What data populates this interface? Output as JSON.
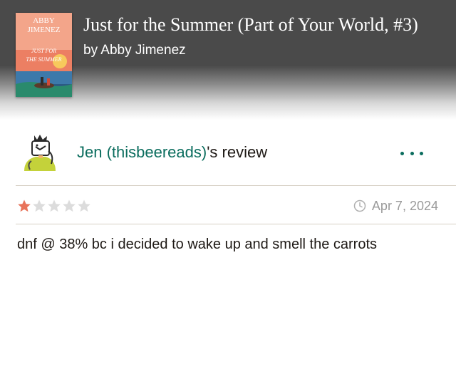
{
  "book": {
    "title": "Just for the Summer (Part of Your World, #3)",
    "author": "by Abby Jimenez",
    "cover": {
      "author_text": "ABBY JIMENEZ",
      "title_text": "JUST FOR THE SUMMER"
    }
  },
  "review": {
    "reviewer_name": "Jen (thisbeereads)",
    "reviewer_suffix": "'s review",
    "rating": 1,
    "max_rating": 5,
    "date": "Apr 7, 2024",
    "text": "dnf @ 38% bc i decided to wake up and smell the carrots"
  },
  "colors": {
    "accent": "#0b6d5e",
    "star_filled": "#e8735a",
    "star_empty": "#dcdcdc"
  },
  "icons": {
    "more": "more-options-icon",
    "clock": "clock-icon",
    "star": "star-icon"
  }
}
